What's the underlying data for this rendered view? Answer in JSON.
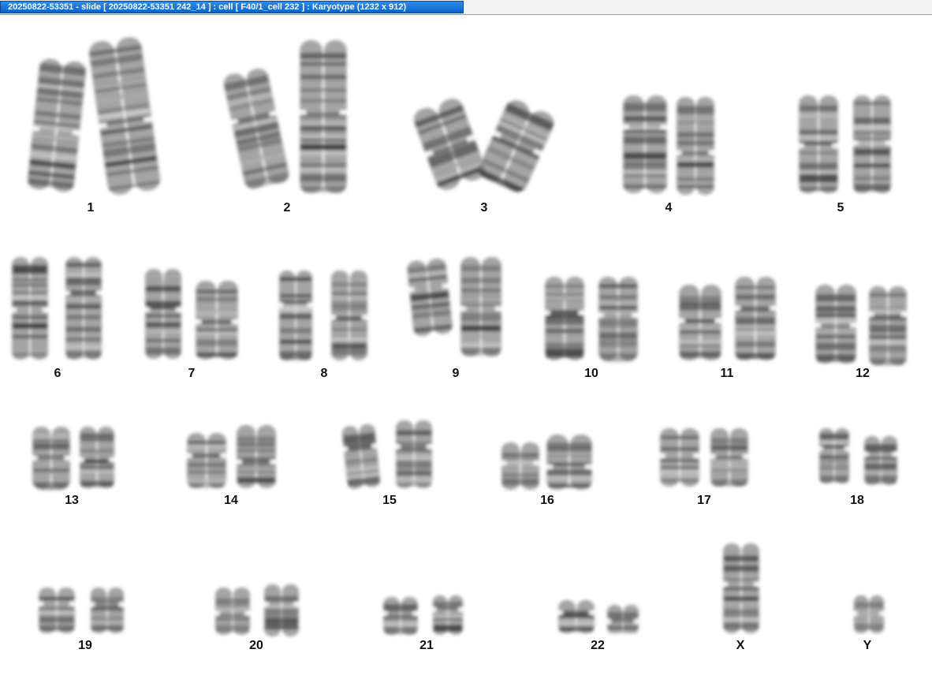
{
  "window": {
    "title": "20250822-53351 - slide [ 20250822-53351 242_14 ] : cell [ F40/1_cell 232 ] : Karyotype  (1232 x 912)"
  },
  "chromosomes": [
    {
      "label": "1",
      "count": 2
    },
    {
      "label": "2",
      "count": 2
    },
    {
      "label": "3",
      "count": 2
    },
    {
      "label": "4",
      "count": 2
    },
    {
      "label": "5",
      "count": 2
    },
    {
      "label": "6",
      "count": 2
    },
    {
      "label": "7",
      "count": 2
    },
    {
      "label": "8",
      "count": 2
    },
    {
      "label": "9",
      "count": 2
    },
    {
      "label": "10",
      "count": 2
    },
    {
      "label": "11",
      "count": 2
    },
    {
      "label": "12",
      "count": 2
    },
    {
      "label": "13",
      "count": 2
    },
    {
      "label": "14",
      "count": 2
    },
    {
      "label": "15",
      "count": 2
    },
    {
      "label": "16",
      "count": 2
    },
    {
      "label": "17",
      "count": 2
    },
    {
      "label": "18",
      "count": 2
    },
    {
      "label": "19",
      "count": 2
    },
    {
      "label": "20",
      "count": 2
    },
    {
      "label": "21",
      "count": 2
    },
    {
      "label": "22",
      "count": 2
    },
    {
      "label": "X",
      "count": 1
    },
    {
      "label": "Y",
      "count": 1
    }
  ]
}
